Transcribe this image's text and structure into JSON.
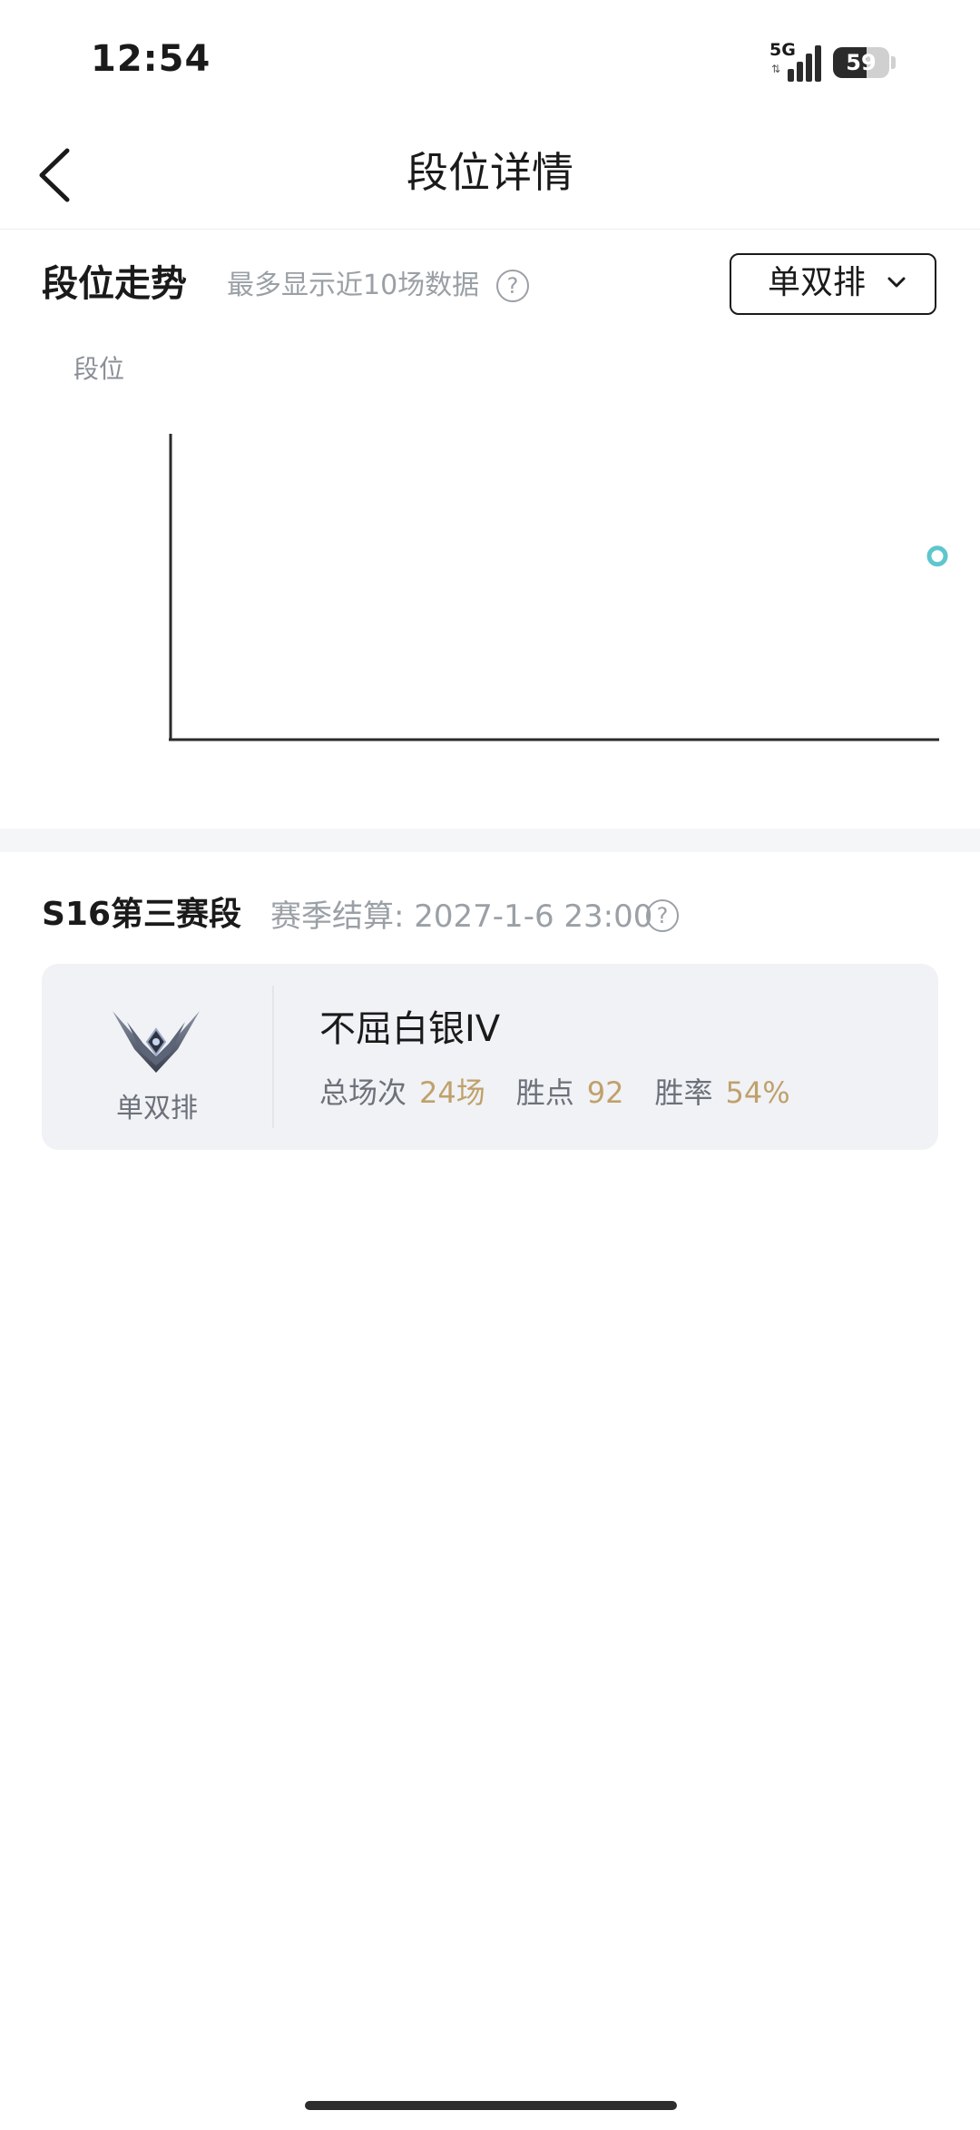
{
  "status_bar": {
    "time": "12:54",
    "network": "5G",
    "battery": "59",
    "battery_level_percent": 59
  },
  "header": {
    "title": "段位详情",
    "back_icon": "chevron-left-icon"
  },
  "trend": {
    "title": "段位走势",
    "subtitle": "最多显示近10场数据",
    "help_icon": "question-circle-icon",
    "mode_selector": {
      "selected": "单双排",
      "icon": "chevron-down-icon"
    },
    "y_axis_label": "段位",
    "point_color": "#5ec6cc"
  },
  "chart_data": {
    "type": "line",
    "ylabel": "段位",
    "xlabel": "",
    "series": [
      {
        "points": [
          {
            "x": 10,
            "y": 0.6
          }
        ]
      }
    ],
    "xlim": [
      0,
      10
    ],
    "ylim": [
      0,
      1
    ],
    "grid": false
  },
  "season": {
    "name": "S16第三赛段",
    "settlement": "赛季结算: 2027-1-6 23:00",
    "help_icon": "question-circle-icon",
    "card": {
      "emblem_icon": "rank-emblem-icon",
      "queue": "单双排",
      "rank": "不屈白银IV",
      "stats": [
        {
          "label": "总场次",
          "value": "24场"
        },
        {
          "label": "胜点",
          "value": "92"
        },
        {
          "label": "胜率",
          "value": "54%"
        }
      ]
    }
  },
  "colors": {
    "accent_gold": "#c0a06c",
    "muted_text": "#9aa0a6",
    "card_bg": "#f0f2f5"
  }
}
